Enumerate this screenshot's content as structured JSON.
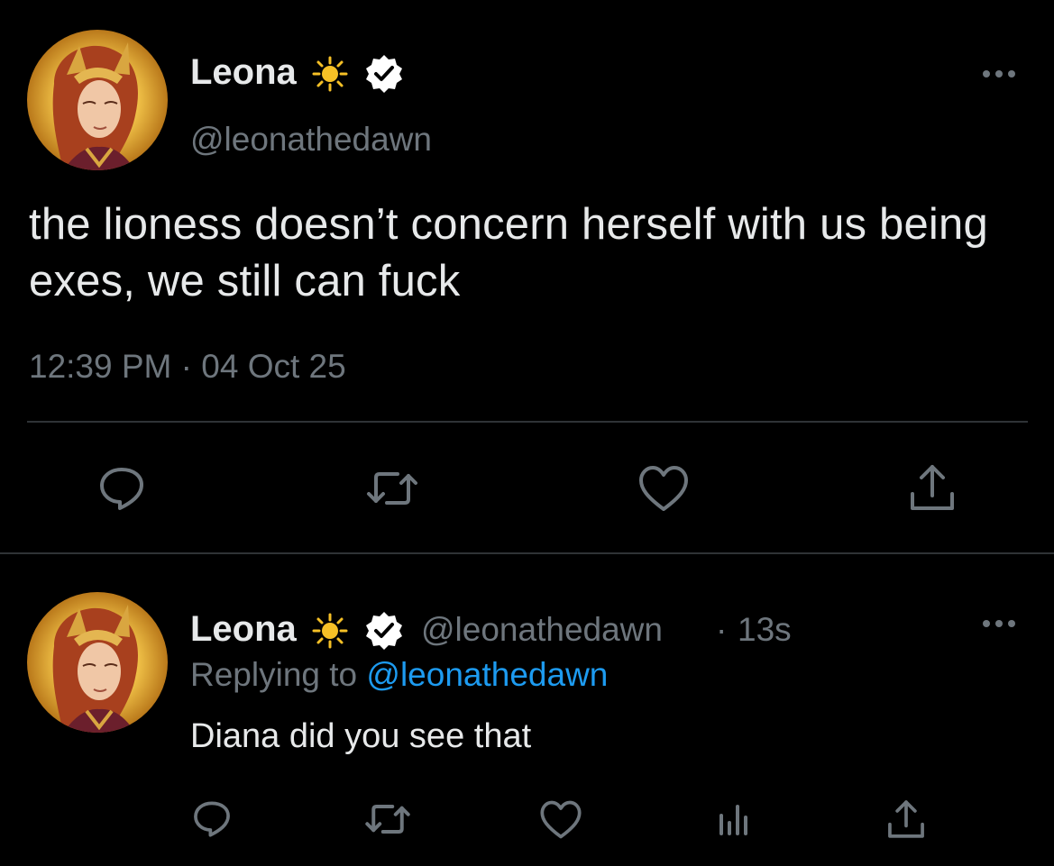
{
  "colors": {
    "background": "#000000",
    "text": "#e7e9ea",
    "muted": "#6e767d",
    "link": "#1d9bf0",
    "divider": "#2f3336",
    "sun": "#f6c026"
  },
  "main_tweet": {
    "avatar_icon": "leona-avatar",
    "author": {
      "name": "Leona",
      "name_emoji": "☀️",
      "verified_icon": "verified-badge-icon",
      "handle": "@leonathedawn"
    },
    "more_icon": "more-options-icon",
    "text": "the lioness doesn’t concern herself with us being exes, we still can fuck",
    "time": "12:39 PM",
    "separator": "·",
    "date": "04 Oct 25",
    "actions": [
      "reply-icon",
      "retweet-icon",
      "like-icon",
      "share-icon"
    ]
  },
  "reply_tweet": {
    "avatar_icon": "leona-avatar",
    "author": {
      "name": "Leona",
      "name_emoji": "☀️",
      "verified_icon": "verified-badge-icon",
      "handle": "@leonathedawn",
      "separator": "·",
      "time_ago": "13s"
    },
    "more_icon": "more-options-icon",
    "replying_prefix": "Replying to",
    "replying_to": "@leonathedawn",
    "text": "Diana did you see that",
    "actions": [
      "reply-icon",
      "retweet-icon",
      "like-icon",
      "analytics-icon",
      "share-icon"
    ]
  }
}
